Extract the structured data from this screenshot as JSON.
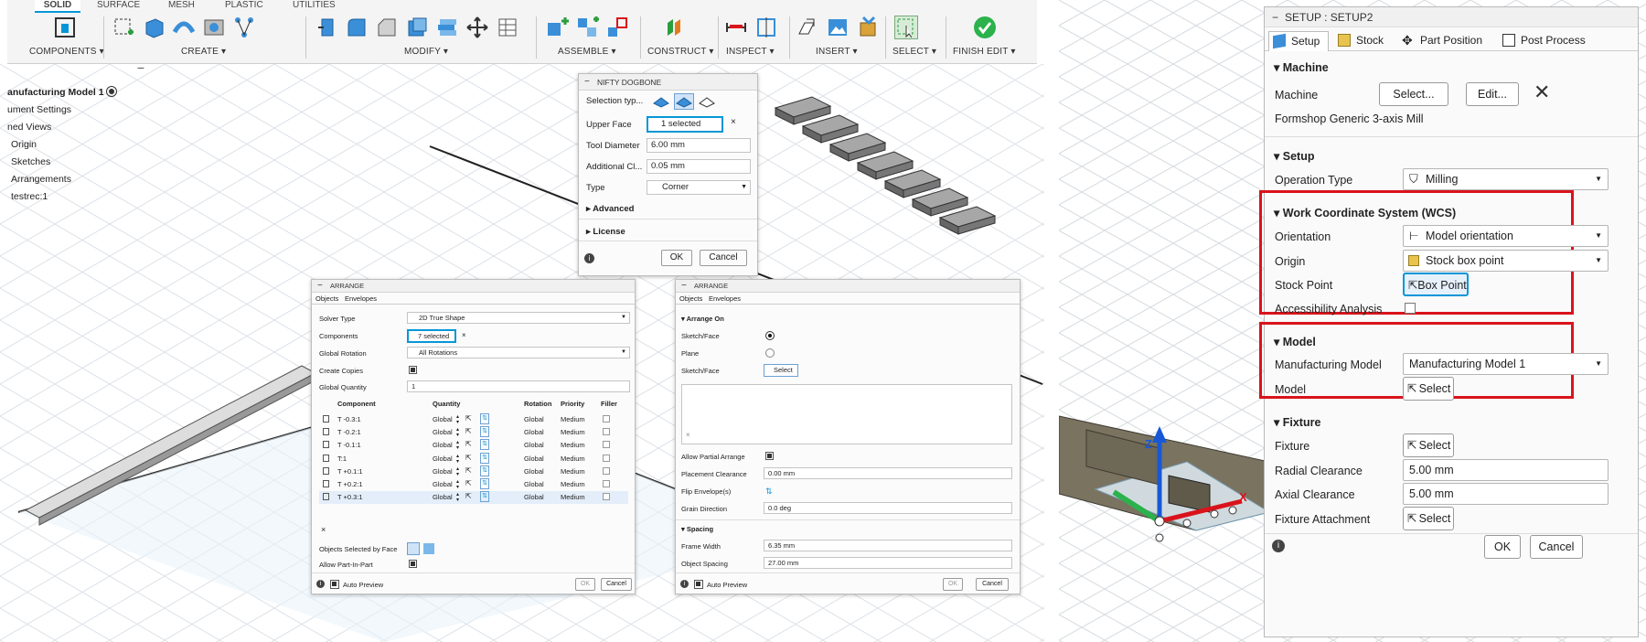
{
  "toolbar": {
    "tabs": [
      "SOLID",
      "SURFACE",
      "MESH",
      "PLASTIC",
      "UTILITIES"
    ],
    "groups": [
      "COMPONENTS ▾",
      "CREATE ▾",
      "MODIFY ▾",
      "ASSEMBLE ▾",
      "CONSTRUCT ▾",
      "INSPECT ▾",
      "INSERT ▾",
      "SELECT ▾",
      "FINISH EDIT ▾"
    ]
  },
  "browser": {
    "items": [
      "anufacturing Model 1",
      "ument Settings",
      "ned Views",
      "Origin",
      "Sketches",
      "Arrangements",
      "testrec:1"
    ]
  },
  "dogbone": {
    "title": "NIFTY DOGBONE",
    "selection_type_label": "Selection typ...",
    "upper_face_label": "Upper Face",
    "upper_face_value": "1 selected",
    "tool_diameter_label": "Tool Diameter",
    "tool_diameter_value": "6.00 mm",
    "additional_label": "Additional Cl...",
    "additional_value": "0.05 mm",
    "type_label": "Type",
    "type_value": "Corner",
    "advanced_label": "Advanced",
    "license_label": "License",
    "ok": "OK",
    "cancel": "Cancel"
  },
  "arrange1": {
    "title": "ARRANGE",
    "tabs": [
      "Objects",
      "Envelopes"
    ],
    "solver_type_label": "Solver Type",
    "solver_type_value": "2D True Shape",
    "components_label": "Components",
    "components_value": "7 selected",
    "global_rotation_label": "Global Rotation",
    "global_rotation_value": "All Rotations",
    "create_copies_label": "Create Copies",
    "global_quantity_label": "Global Quantity",
    "global_quantity_value": "1",
    "columns": [
      "Component",
      "Quantity",
      "Rotation",
      "Priority",
      "Filler"
    ],
    "rows": [
      {
        "component": "T -0.3:1",
        "quantity": "Global",
        "rotation": "Global",
        "priority": "Medium"
      },
      {
        "component": "T -0.2:1",
        "quantity": "Global",
        "rotation": "Global",
        "priority": "Medium"
      },
      {
        "component": "T -0.1:1",
        "quantity": "Global",
        "rotation": "Global",
        "priority": "Medium"
      },
      {
        "component": "T:1",
        "quantity": "Global",
        "rotation": "Global",
        "priority": "Medium"
      },
      {
        "component": "T +0.1:1",
        "quantity": "Global",
        "rotation": "Global",
        "priority": "Medium"
      },
      {
        "component": "T +0.2:1",
        "quantity": "Global",
        "rotation": "Global",
        "priority": "Medium"
      },
      {
        "component": "T +0.3:1",
        "quantity": "Global",
        "rotation": "Global",
        "priority": "Medium"
      }
    ],
    "objects_selected_label": "Objects Selected by Face",
    "allow_part_label": "Allow Part-In-Part",
    "auto_preview": "Auto Preview",
    "ok": "OK",
    "cancel": "Cancel"
  },
  "arrange2": {
    "title": "ARRANGE",
    "tabs": [
      "Objects",
      "Envelopes"
    ],
    "arrange_on_label": "Arrange On",
    "sketch_face_label": "Sketch/Face",
    "plane_label": "Plane",
    "sketch_face2_label": "Sketch/Face",
    "select_label": "Select",
    "allow_partial_label": "Allow Partial Arrange",
    "placement_clearance_label": "Placement Clearance",
    "placement_clearance_value": "0.00 mm",
    "flip_envelope_label": "Flip Envelope(s)",
    "grain_direction_label": "Grain Direction",
    "grain_direction_value": "0.0 deg",
    "spacing_label": "Spacing",
    "frame_width_label": "Frame Width",
    "frame_width_value": "6.35 mm",
    "object_spacing_label": "Object Spacing",
    "object_spacing_value": "27.00 mm",
    "auto_preview": "Auto Preview",
    "ok": "OK",
    "cancel": "Cancel"
  },
  "setup": {
    "title": "SETUP : SETUP2",
    "tabs": [
      "Setup",
      "Stock",
      "Part Position",
      "Post Process"
    ],
    "machine_section": "Machine",
    "machine_label": "Machine",
    "machine_select": "Select...",
    "machine_edit": "Edit...",
    "machine_name": "Formshop Generic 3-axis Mill",
    "setup_section": "Setup",
    "operation_type_label": "Operation Type",
    "operation_type_value": "Milling",
    "wcs_section": "Work Coordinate System (WCS)",
    "orientation_label": "Orientation",
    "orientation_value": "Model orientation",
    "origin_label": "Origin",
    "origin_value": "Stock box point",
    "stock_point_label": "Stock Point",
    "stock_point_value": "Box Point",
    "accessibility_label": "Accessibility Analysis",
    "model_section": "Model",
    "manufacturing_model_label": "Manufacturing Model",
    "manufacturing_model_value": "Manufacturing Model 1",
    "model_label": "Model",
    "model_select": "Select",
    "fixture_section": "Fixture",
    "fixture_label": "Fixture",
    "fixture_select": "Select",
    "radial_clearance_label": "Radial Clearance",
    "radial_clearance_value": "5.00 mm",
    "axial_clearance_label": "Axial Clearance",
    "axial_clearance_value": "5.00 mm",
    "fixture_attachment_label": "Fixture Attachment",
    "fixture_attachment_select": "Select",
    "ok": "OK",
    "cancel": "Cancel"
  },
  "axes": {
    "x": "X",
    "z": "Z"
  },
  "colors": {
    "accent": "#0696d7",
    "highlight": "#d9131b",
    "grid": "#d8dde3"
  }
}
